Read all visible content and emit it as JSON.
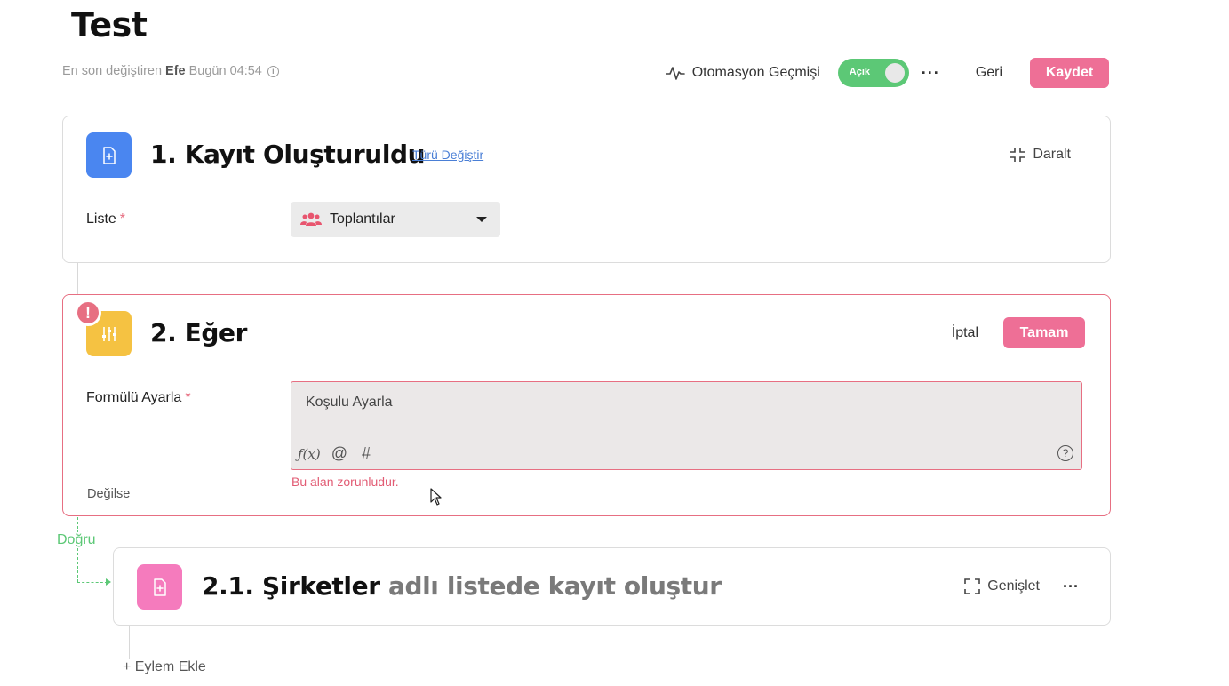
{
  "page": {
    "title": "Test"
  },
  "meta": {
    "prefix": "En son değiştiren",
    "user": "Efe",
    "time": "Bugün 04:54",
    "info_icon": "info-icon"
  },
  "header": {
    "history_label": "Otomasyon Geçmişi",
    "history_icon": "activity-icon",
    "toggle_label": "Açık",
    "toggle_on": true,
    "more_label": "···",
    "back_label": "Geri",
    "save_label": "Kaydet"
  },
  "steps": [
    {
      "title": "1. Kayıt Oluşturuldu",
      "change_type_label": "Türü Değiştir",
      "collapse_label": "Daralt",
      "icon": "file-plus-icon",
      "icon_color": "#4a86f0",
      "field_label": "Liste",
      "required_mark": "*",
      "select_value": "Toplantılar",
      "select_icon": "users-icon"
    },
    {
      "title": "2. Eğer",
      "icon": "sliders-icon",
      "icon_color": "#f5c242",
      "error_badge": "!",
      "cancel_label": "İptal",
      "ok_label": "Tamam",
      "field_label": "Formülü Ayarla",
      "required_mark": "*",
      "formula_placeholder": "Koşulu Ayarla",
      "tool_fx": "ƒ(x)",
      "tool_at": "@",
      "tool_hash": "#",
      "help": "?",
      "error_message": "Bu alan zorunludur.",
      "else_label": "Değilse"
    },
    {
      "title_strong": "2.1. Şirketler",
      "title_muted": "adlı listede kayıt oluştur",
      "icon": "file-plus-icon",
      "icon_color": "#f57bbd",
      "expand_label": "Genişlet",
      "more_label": "···"
    }
  ],
  "branch": {
    "true_label": "Doğru"
  },
  "add_action_label": "+ Eylem Ekle",
  "colors": {
    "accent": "#ee6f96",
    "success": "#5cc876",
    "error": "#e76f82",
    "link": "#4a7fd6"
  }
}
